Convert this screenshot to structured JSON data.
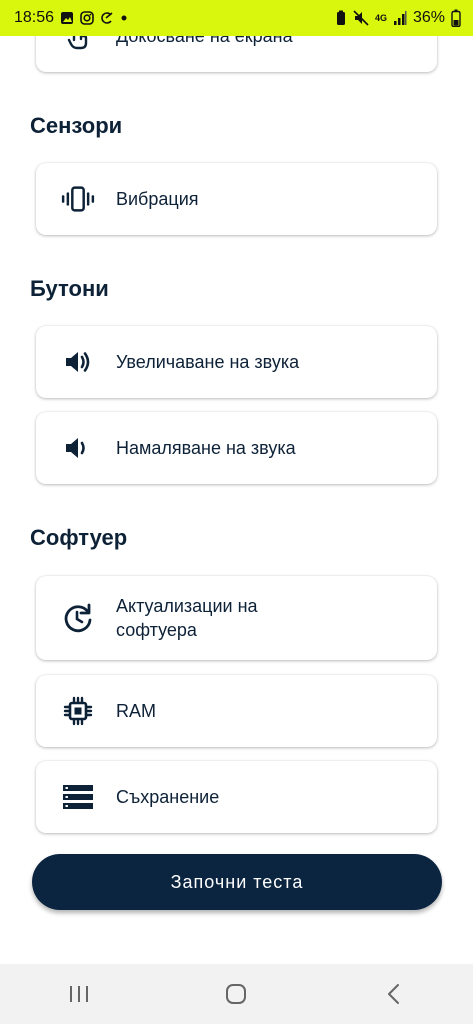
{
  "status_bar": {
    "time": "18:56",
    "battery_percent": "36%",
    "network": "4G",
    "bg_color": "#d9f70c",
    "left_icons": [
      "gallery-icon",
      "instagram-icon",
      "app-icon",
      "dot-icon"
    ],
    "right_icons": [
      "battery-saver-icon",
      "mute-icon",
      "signal-icon"
    ]
  },
  "sections": {
    "screen": {
      "items": [
        {
          "label": "Докосване на екрана",
          "icon": "touch-icon"
        }
      ]
    },
    "sensors": {
      "title": "Сензори",
      "items": [
        {
          "label": "Вибрация",
          "icon": "vibration-icon"
        }
      ]
    },
    "buttons": {
      "title": "Бутони",
      "items": [
        {
          "label": "Увеличаване на звука",
          "icon": "volume-up-icon"
        },
        {
          "label": "Намаляване на звука",
          "icon": "volume-down-icon"
        }
      ]
    },
    "software": {
      "title": "Софтуер",
      "items": [
        {
          "label": "Актуализации на софтуера",
          "icon": "update-icon"
        },
        {
          "label": "RAM",
          "icon": "chip-icon"
        },
        {
          "label": "Съхранение",
          "icon": "storage-icon"
        }
      ]
    }
  },
  "start_button": {
    "label": "Започни теста"
  },
  "colors": {
    "primary": "#0b2440",
    "text": "#0d2137"
  },
  "nav_bar": {
    "icons": [
      "recent-apps-icon",
      "home-icon",
      "back-icon"
    ]
  }
}
